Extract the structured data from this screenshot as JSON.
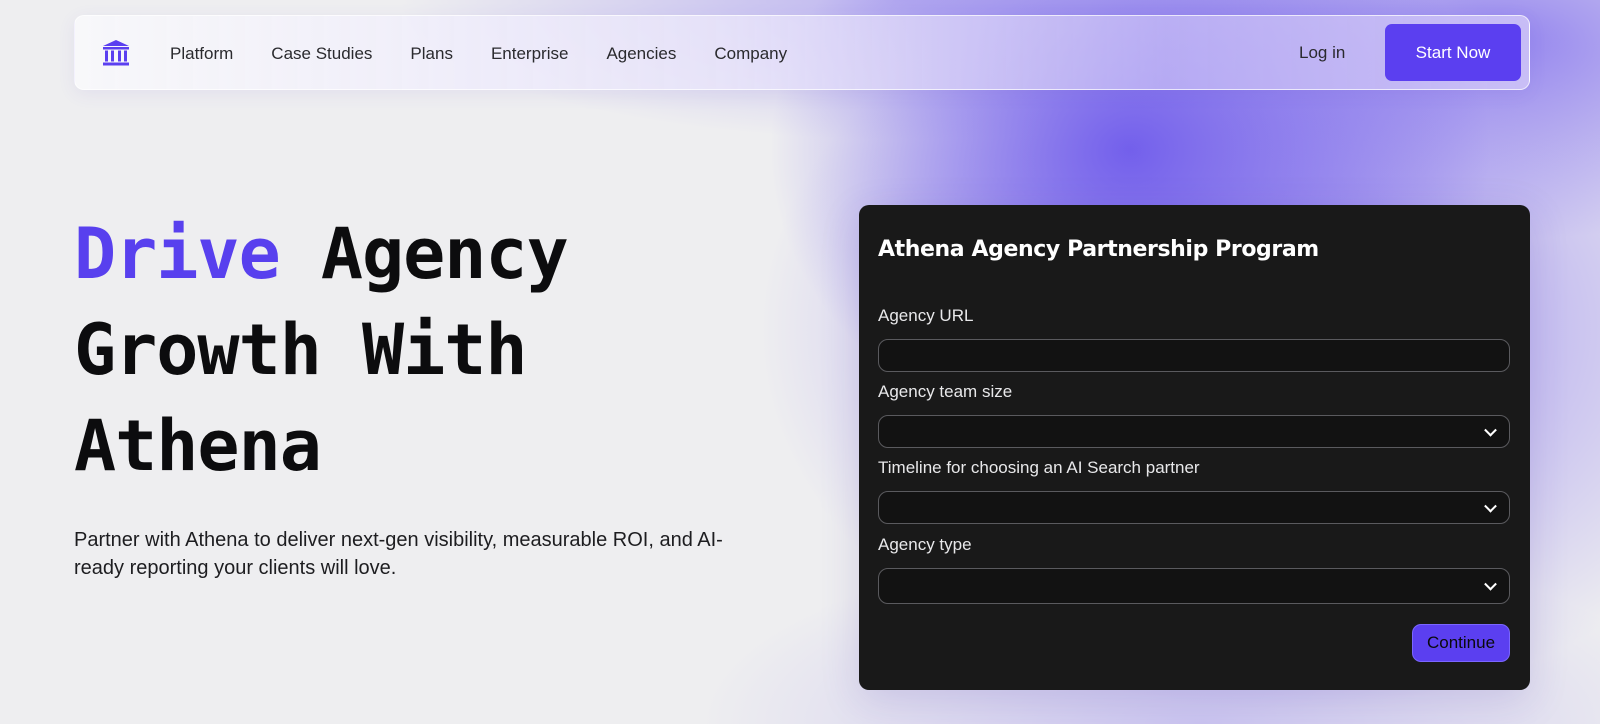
{
  "nav": {
    "logo_icon": "bank-columns-icon",
    "links": [
      "Platform",
      "Case Studies",
      "Plans",
      "Enterprise",
      "Agencies",
      "Company"
    ],
    "login_label": "Log in",
    "cta_label": "Start Now"
  },
  "hero": {
    "title_accent": "Drive",
    "title_line1_rest": " Agency",
    "title_line2": "Growth With",
    "title_line3": "Athena",
    "subtitle": "Partner with Athena to deliver next-gen visibility, measurable ROI, and AI-ready reporting your clients will love."
  },
  "form": {
    "title": "Athena Agency Partnership Program",
    "fields": [
      {
        "label": "Agency URL",
        "value": ""
      },
      {
        "label": "Agency team size",
        "value": ""
      },
      {
        "label": "Timeline for choosing an AI Search partner",
        "value": ""
      },
      {
        "label": "Agency type",
        "value": ""
      }
    ],
    "submit_label": "Continue"
  },
  "colors": {
    "accent": "#5b3ff0",
    "card_bg": "#191919",
    "page_bg": "#eeeef0"
  }
}
